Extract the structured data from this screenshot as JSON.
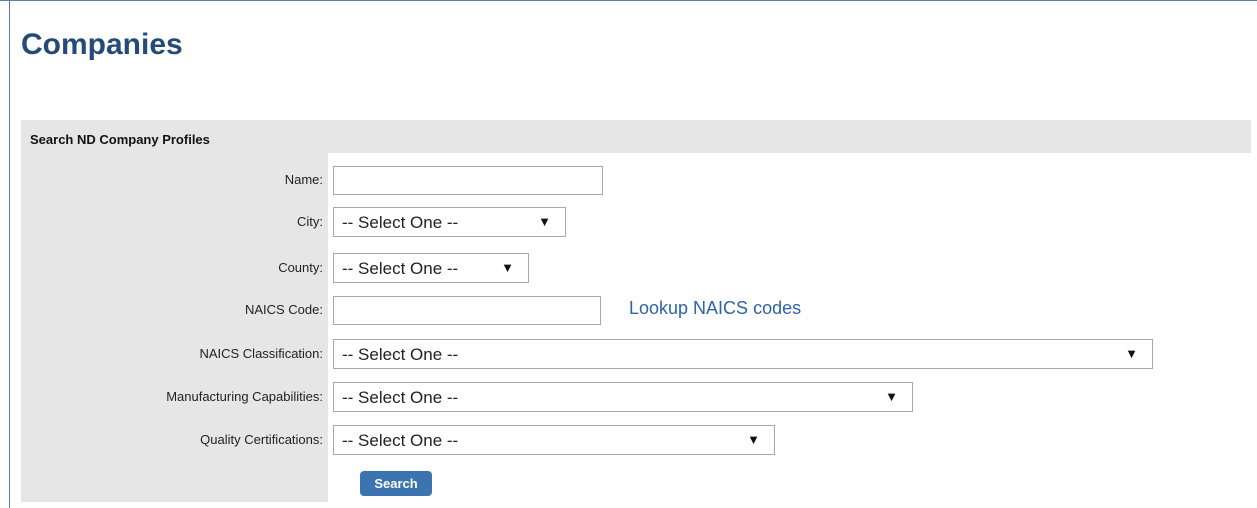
{
  "page": {
    "title": "Companies"
  },
  "search_panel": {
    "title": "Search ND Company Profiles",
    "fields": {
      "name": {
        "label": "Name:",
        "value": ""
      },
      "city": {
        "label": "City:",
        "selected": "-- Select One --"
      },
      "county": {
        "label": "County:",
        "selected": "-- Select One --"
      },
      "naics_code": {
        "label": "NAICS Code:",
        "value": "",
        "lookup_link": "Lookup NAICS codes"
      },
      "naics_classification": {
        "label": "NAICS Classification:",
        "selected": "-- Select One --"
      },
      "manufacturing_capabilities": {
        "label": "Manufacturing Capabilities:",
        "selected": "-- Select One --"
      },
      "quality_certifications": {
        "label": "Quality Certifications:",
        "selected": "-- Select One --"
      }
    },
    "dropdown_arrow": "▼",
    "search_button": "Search"
  }
}
